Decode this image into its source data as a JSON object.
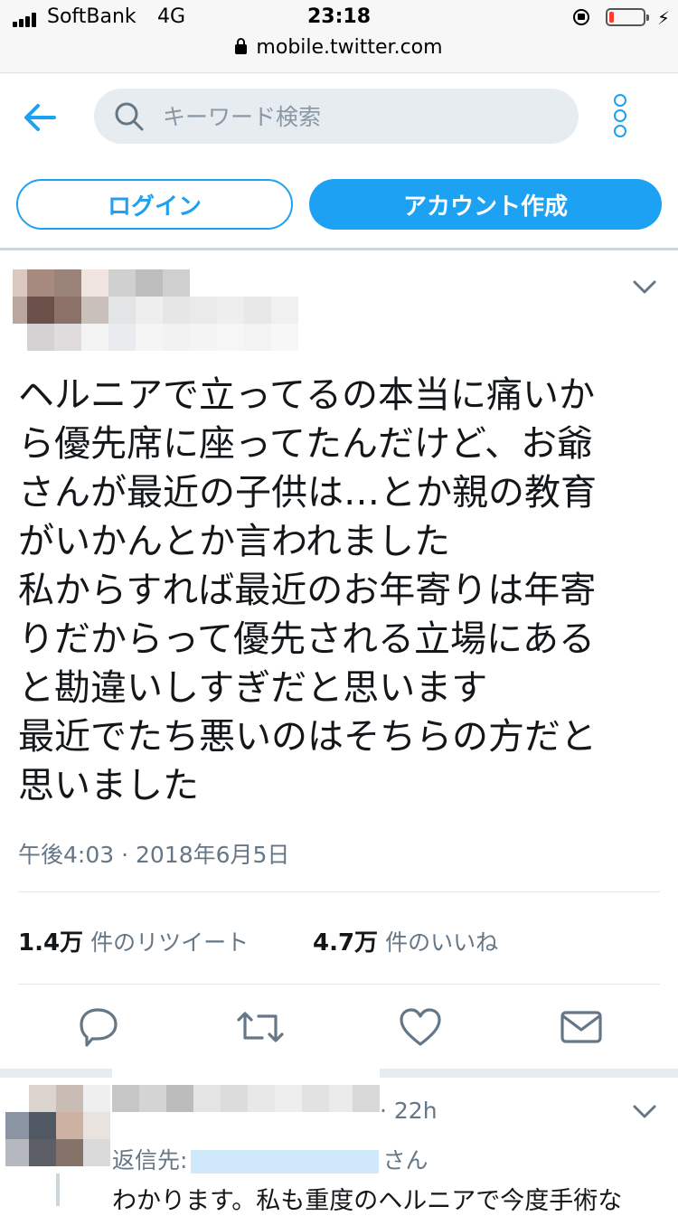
{
  "status_bar": {
    "carrier": "SoftBank",
    "network": "4G",
    "time": "23:18",
    "url": "mobile.twitter.com",
    "battery_level": 0.15,
    "battery_color": "#ff3b30"
  },
  "header": {
    "back_icon": "arrow-left-icon",
    "search_placeholder": "キーワード検索",
    "search_icon": "search-icon",
    "more_icon": "more-vertical-icon"
  },
  "auth": {
    "login_label": "ログイン",
    "signup_label": "アカウント作成"
  },
  "tweet": {
    "text": "ヘルニアで立ってるの本当に痛いか\nら優先席に座ってたんだけど、お爺\nさんが最近の子供は…とか親の教育\nがいかんとか言われました\n私からすれば最近のお年寄りは年寄\nりだからって優先される立場にある\nと勘違いしすぎだと思います\n最近でたち悪いのはそちらの方だと\n思いました",
    "timestamp": "午後4:03 · 2018年6月5日",
    "retweets_count": "1.4万",
    "retweets_label": "件のリツイート",
    "likes_count": "4.7万",
    "likes_label": "件のいいね",
    "actions": [
      "reply-icon",
      "retweet-icon",
      "like-icon",
      "direct-message-icon"
    ]
  },
  "reply": {
    "meta": "· 22h",
    "reply_to_prefix": "返信先:",
    "reply_to_suffix": "さん",
    "text": "わかります。私も重度のヘルニアで今度手術な"
  },
  "colors": {
    "accent": "#1da1f2",
    "secondary_text": "#657786",
    "search_bg": "#e6ecf0"
  }
}
